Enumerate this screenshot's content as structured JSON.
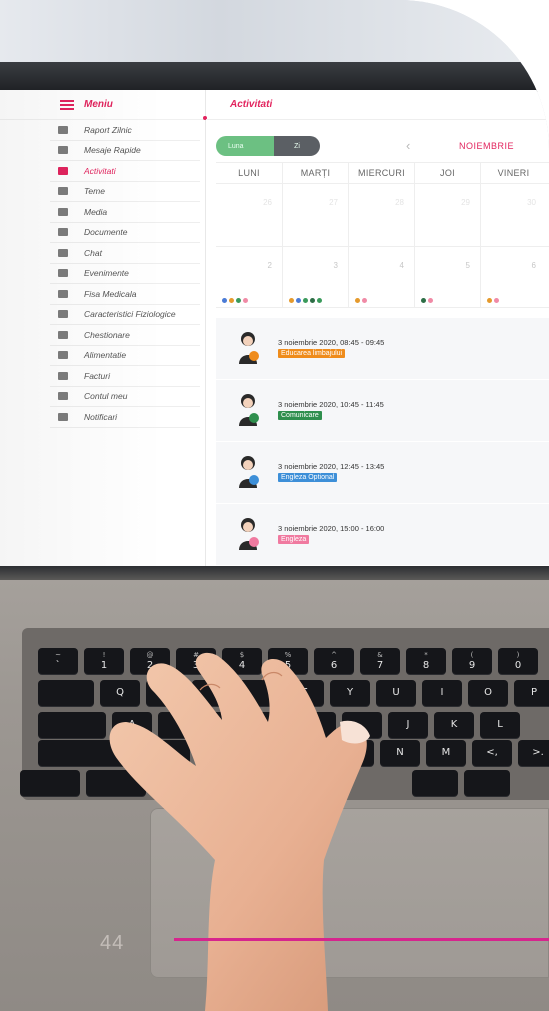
{
  "sidebar": {
    "menu_label": "Meniu",
    "items": [
      {
        "label": "Raport Zilnic",
        "icon": "checkbox-icon",
        "active": false
      },
      {
        "label": "Mesaje Rapide",
        "icon": "chat-bubbles-icon",
        "active": false
      },
      {
        "label": "Activitati",
        "icon": "activity-icon",
        "active": true
      },
      {
        "label": "Teme",
        "icon": "book-icon",
        "active": false
      },
      {
        "label": "Media",
        "icon": "photo-icon",
        "active": false
      },
      {
        "label": "Documente",
        "icon": "document-icon",
        "active": false
      },
      {
        "label": "Chat",
        "icon": "chat-icon",
        "active": false
      },
      {
        "label": "Evenimente",
        "icon": "calendar-icon",
        "active": false
      },
      {
        "label": "Fisa Medicala",
        "icon": "medical-plus-icon",
        "active": false
      },
      {
        "label": "Caracteristici Fiziologice",
        "icon": "pulse-icon",
        "active": false
      },
      {
        "label": "Chestionare",
        "icon": "bar-chart-icon",
        "active": false
      },
      {
        "label": "Alimentatie",
        "icon": "food-icon",
        "active": false
      },
      {
        "label": "Facturi",
        "icon": "invoice-icon",
        "active": false
      },
      {
        "label": "Contul meu",
        "icon": "user-icon",
        "active": false
      },
      {
        "label": "Notificari",
        "icon": "globe-icon",
        "active": false
      }
    ]
  },
  "header": {
    "title": "Activitati"
  },
  "view_toggle": {
    "month_label": "Luna",
    "day_label": "Zi",
    "selected": "Luna"
  },
  "month_label": "NOIEMBRIE",
  "calendar": {
    "weekdays": [
      "LUNI",
      "MARȚI",
      "MIERCURI",
      "JOI",
      "VINERI"
    ],
    "week1_days": [
      "26",
      "27",
      "28",
      "29",
      "30"
    ],
    "week2_days": [
      "2",
      "3",
      "4",
      "5",
      "6"
    ],
    "week2_dots": [
      [
        "#4a7bd6",
        "#e59a2c",
        "#3a9a5b",
        "#f08aa6"
      ],
      [
        "#e59a2c",
        "#4a7bd6",
        "#3a9a5b",
        "#2d6e46",
        "#3a9a5b"
      ],
      [
        "#e59a2c",
        "#f08aa6"
      ],
      [
        "#2d6e46",
        "#f08aa6"
      ],
      [
        "#e59a2c",
        "#f08aa6"
      ]
    ]
  },
  "events": [
    {
      "when": "3 noiembrie 2020, 08:45 - 09:45",
      "tag": "Educarea limbajului",
      "color": "#ef8c1c",
      "icon": "child-speech-icon"
    },
    {
      "when": "3 noiembrie 2020, 10:45 - 11:45",
      "tag": "Comunicare",
      "color": "#2f8f4e",
      "icon": "child-globe-icon"
    },
    {
      "when": "3 noiembrie 2020, 12:45 - 13:45",
      "tag": "Engleza Optional",
      "color": "#3d8fd8",
      "icon": "child-flag-icon"
    },
    {
      "when": "3 noiembrie 2020, 15:00 - 16:00",
      "tag": "Engleza",
      "color": "#f07aa0",
      "icon": "child-abc-icon"
    }
  ],
  "keyboard": {
    "number_row": [
      {
        "top": "~",
        "bottom": "`"
      },
      {
        "top": "!",
        "bottom": "1"
      },
      {
        "top": "@",
        "bottom": "2"
      },
      {
        "top": "#",
        "bottom": "3"
      },
      {
        "top": "$",
        "bottom": "4"
      },
      {
        "top": "%",
        "bottom": "5"
      },
      {
        "top": "^",
        "bottom": "6"
      },
      {
        "top": "&",
        "bottom": "7"
      },
      {
        "top": "*",
        "bottom": "8"
      },
      {
        "top": "(",
        "bottom": "9"
      },
      {
        "top": ")",
        "bottom": "0"
      }
    ],
    "row_q": [
      "Q",
      "",
      "",
      "",
      "T",
      "Y",
      "U",
      "I",
      "O",
      "P"
    ],
    "row_a": [
      "A",
      "",
      "",
      "",
      "G",
      "",
      "J",
      "K",
      "L"
    ],
    "row_z": [
      "",
      "",
      "",
      "",
      "",
      "N",
      "M",
      "<,",
      ">."
    ]
  },
  "page_number": "44"
}
